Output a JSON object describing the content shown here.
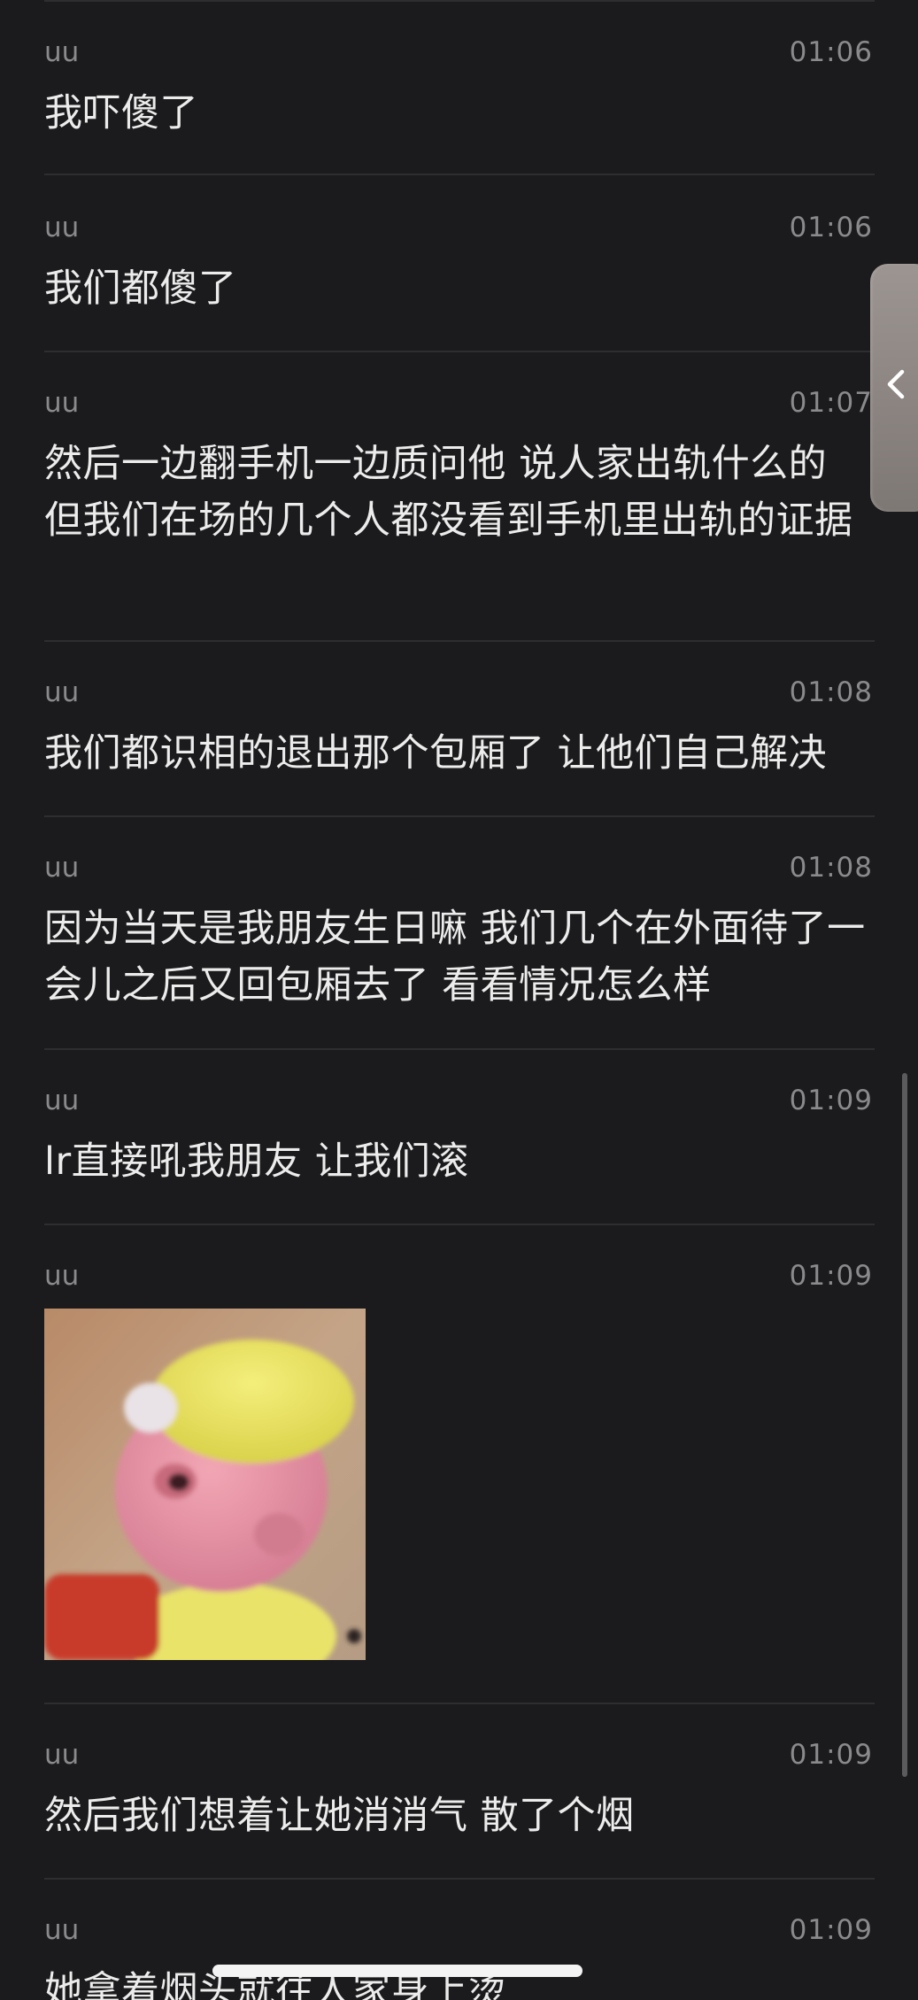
{
  "messages": [
    {
      "sender": "uu",
      "time": "01:06",
      "text": "我吓傻了"
    },
    {
      "sender": "uu",
      "time": "01:06",
      "text": "我们都傻了"
    },
    {
      "sender": "uu",
      "time": "01:07",
      "text": "然后一边翻手机一边质问他 说人家出轨什么的 但我们在场的几个人都没看到手机里出轨的证据"
    },
    {
      "sender": "uu",
      "time": "01:08",
      "text": "我们都识相的退出那个包厢了 让他们自己解决"
    },
    {
      "sender": "uu",
      "time": "01:08",
      "text": "因为当天是我朋友生日嘛 我们几个在外面待了一会儿之后又回包厢去了 看看情况怎么样"
    },
    {
      "sender": "uu",
      "time": "01:09",
      "text": "lr直接吼我朋友 让我们滚"
    },
    {
      "sender": "uu",
      "time": "01:09",
      "sticker": "pink-cartoon-character-yellow-hat-sticker"
    },
    {
      "sender": "uu",
      "time": "01:09",
      "text": "然后我们想着让她消消气 散了个烟"
    },
    {
      "sender": "uu",
      "time": "01:09",
      "text": "她拿着烟头就往人家身上烫"
    }
  ],
  "icons": {
    "side_tab": "chevron-left-icon"
  },
  "colors": {
    "background": "#1b1b1d",
    "text": "#ececec",
    "meta": "#8a8a8c",
    "separator": "#2e2e31",
    "side_tab": "#958f8b",
    "home_indicator": "#f4f4f4"
  }
}
